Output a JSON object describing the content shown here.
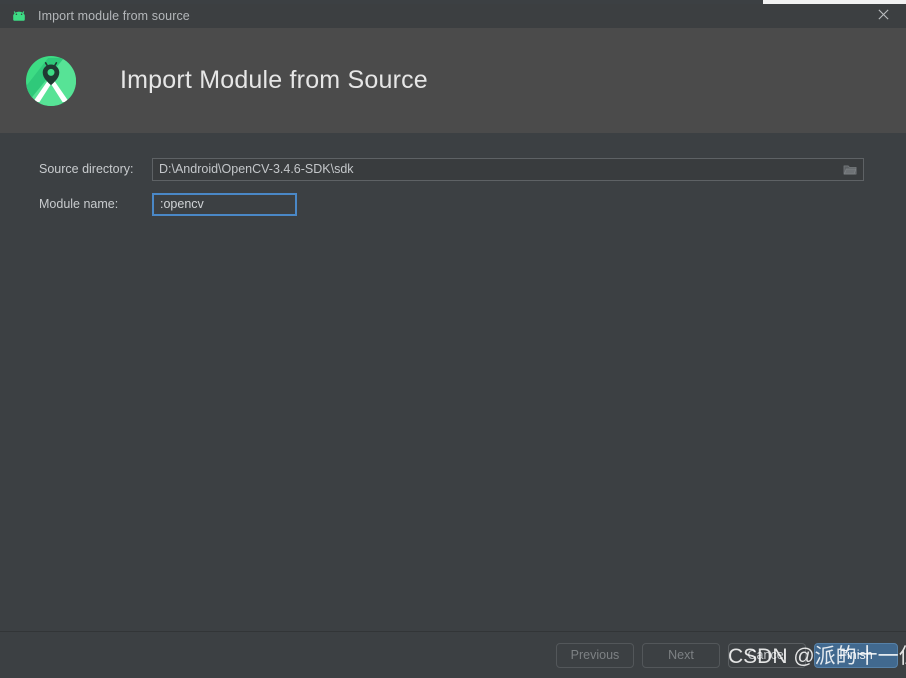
{
  "window": {
    "titlebar_title": "Import module from source",
    "titlebar_icon": "android-robot-icon",
    "close_icon": "close-icon"
  },
  "header": {
    "logo_icon": "android-studio-logo-icon",
    "title": "Import Module from Source"
  },
  "form": {
    "source_directory": {
      "label": "Source directory:",
      "value": "D:\\Android\\OpenCV-3.4.6-SDK\\sdk",
      "browse_icon": "folder-browse-icon"
    },
    "module_name": {
      "label": "Module name:",
      "value": ":opencv",
      "focused": true
    }
  },
  "buttons": {
    "previous": "Previous",
    "next": "Next",
    "cancel": "Cancel",
    "finish": "Finish"
  },
  "watermark": {
    "text": "CSDN @派的十一位"
  },
  "colors": {
    "titlebar_bg": "#3c3f41",
    "header_bg": "#4b4b4b",
    "body_bg": "#3c4043",
    "accent_focus": "#4a88c7",
    "primary_button": "#41698f",
    "logo_green": "#3ddc84",
    "text_primary": "#c8cbce"
  }
}
